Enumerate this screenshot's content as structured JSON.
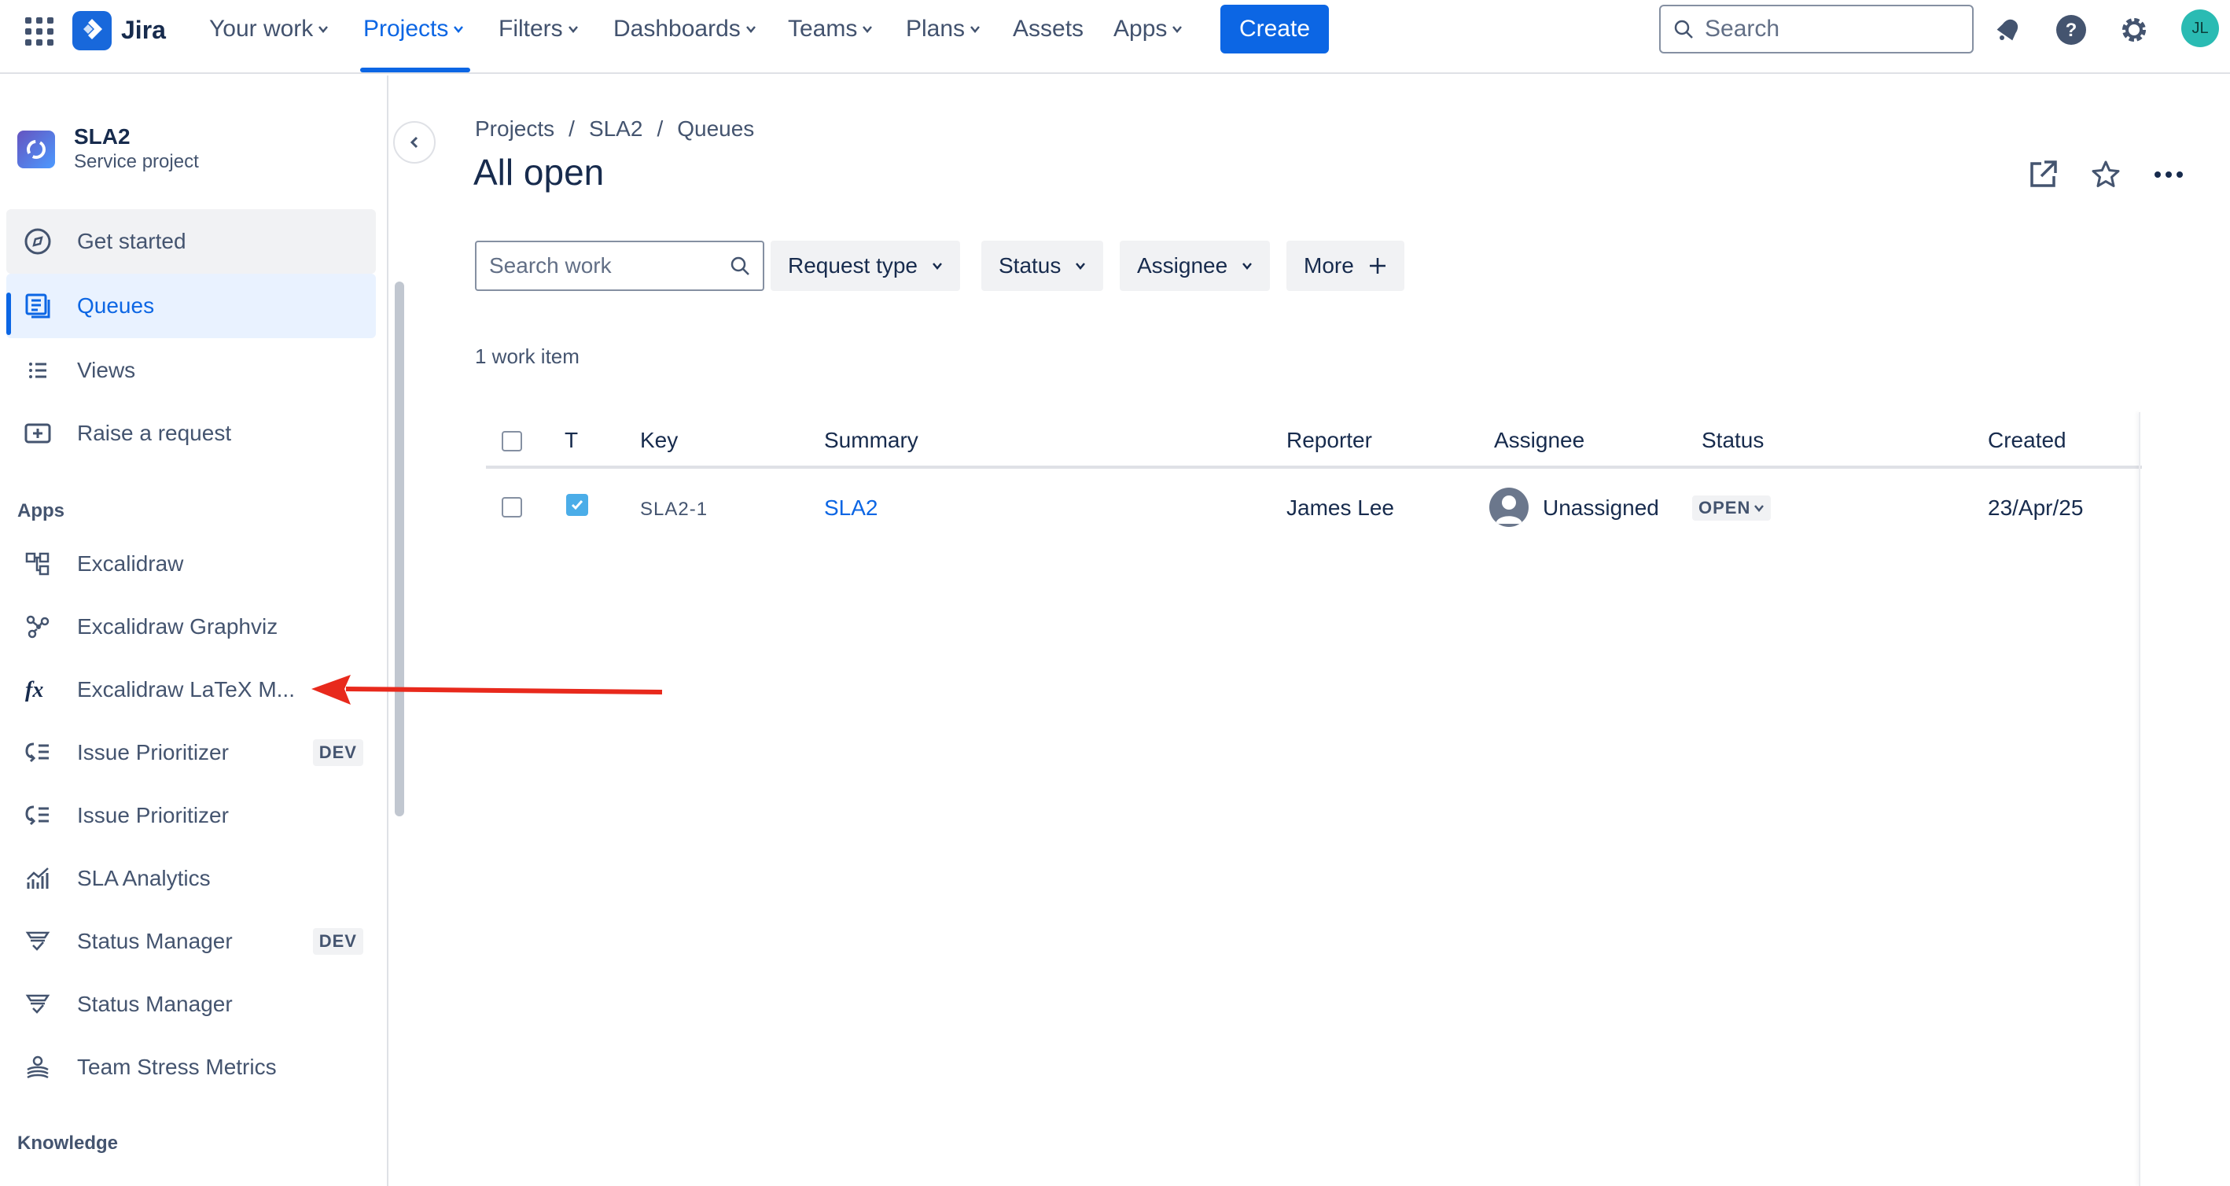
{
  "topnav": {
    "brand": "Jira",
    "items": [
      {
        "label": "Your work",
        "dropdown": true
      },
      {
        "label": "Projects",
        "dropdown": true,
        "active": true
      },
      {
        "label": "Filters",
        "dropdown": true
      },
      {
        "label": "Dashboards",
        "dropdown": true
      },
      {
        "label": "Teams",
        "dropdown": true
      },
      {
        "label": "Plans",
        "dropdown": true
      },
      {
        "label": "Assets",
        "dropdown": false
      },
      {
        "label": "Apps",
        "dropdown": true
      }
    ],
    "create_label": "Create",
    "search_placeholder": "Search",
    "avatar_initials": "JL",
    "accent_color": "#0c66e4"
  },
  "sidebar": {
    "project_name": "SLA2",
    "project_type": "Service project",
    "items": [
      {
        "label": "Get started",
        "icon": "compass-icon"
      },
      {
        "label": "Queues",
        "icon": "queues-icon",
        "selected": true
      },
      {
        "label": "Views",
        "icon": "list-icon"
      },
      {
        "label": "Raise a request",
        "icon": "raise-request-icon"
      }
    ],
    "apps_heading": "Apps",
    "apps": [
      {
        "label": "Excalidraw",
        "icon": "diagram-icon"
      },
      {
        "label": "Excalidraw Graphviz",
        "icon": "graph-icon"
      },
      {
        "label": "Excalidraw LaTeX M...",
        "icon": "fx-icon"
      },
      {
        "label": "Issue Prioritizer",
        "icon": "prioritizer-icon",
        "badge": "DEV"
      },
      {
        "label": "Issue Prioritizer",
        "icon": "prioritizer-icon"
      },
      {
        "label": "SLA Analytics",
        "icon": "analytics-icon"
      },
      {
        "label": "Status Manager",
        "icon": "status-manager-icon",
        "badge": "DEV"
      },
      {
        "label": "Status Manager",
        "icon": "status-manager-icon"
      },
      {
        "label": "Team Stress Metrics",
        "icon": "stress-metrics-icon"
      }
    ],
    "knowledge_heading": "Knowledge"
  },
  "main": {
    "breadcrumbs": [
      "Projects",
      "/",
      "SLA2",
      "/",
      "Queues"
    ],
    "title": "All open",
    "search_placeholder": "Search work",
    "filters": [
      {
        "label": "Request type"
      },
      {
        "label": "Status"
      },
      {
        "label": "Assignee"
      }
    ],
    "more_label": "More",
    "count_text": "1 work item",
    "table": {
      "headers": {
        "type": "T",
        "key": "Key",
        "summary": "Summary",
        "reporter": "Reporter",
        "assignee": "Assignee",
        "status": "Status",
        "created": "Created"
      },
      "rows": [
        {
          "key": "SLA2-1",
          "summary": "SLA2",
          "reporter": "James Lee",
          "assignee": "Unassigned",
          "status": "OPEN",
          "created": "23/Apr/25"
        }
      ]
    }
  }
}
